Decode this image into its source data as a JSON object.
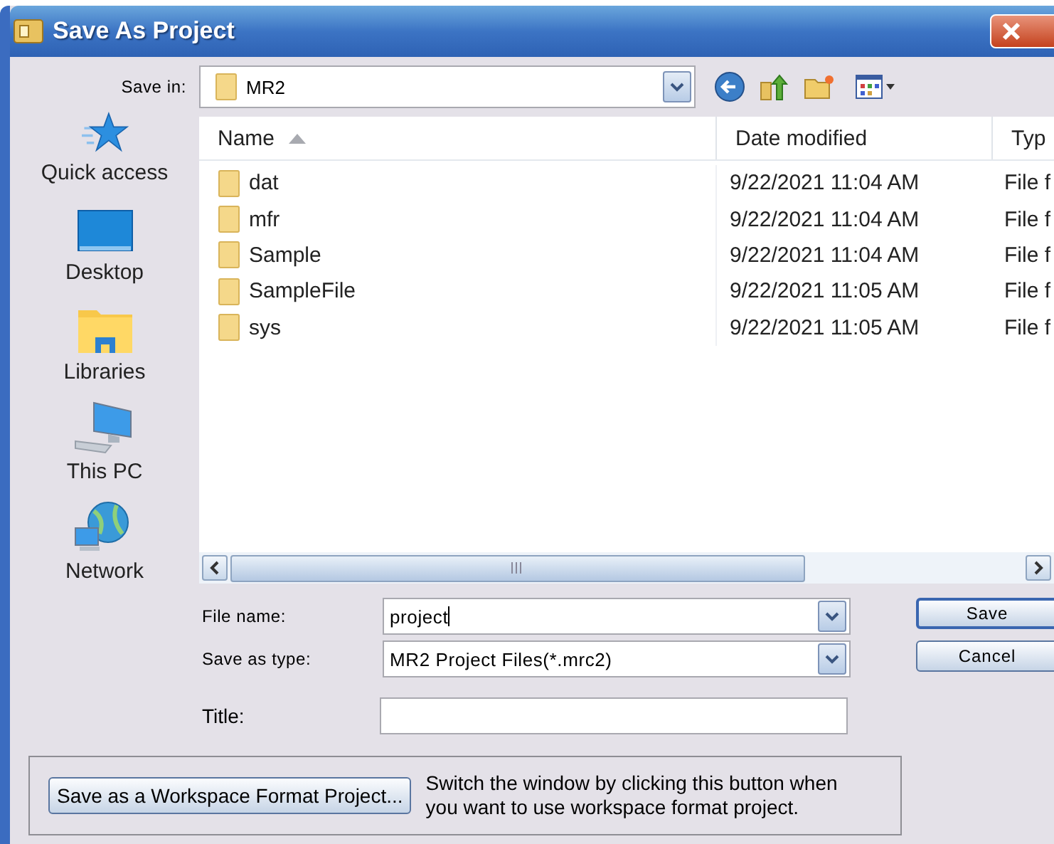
{
  "window": {
    "title": "Save As Project"
  },
  "save_in": {
    "label": "Save in:",
    "value": "MR2"
  },
  "places": [
    {
      "label": "Quick access",
      "kind": "star"
    },
    {
      "label": "Desktop",
      "kind": "desktop"
    },
    {
      "label": "Libraries",
      "kind": "libraries"
    },
    {
      "label": "This PC",
      "kind": "pc"
    },
    {
      "label": "Network",
      "kind": "network"
    }
  ],
  "columns": [
    {
      "label": "Name",
      "sorted": true
    },
    {
      "label": "Date modified",
      "sorted": false
    },
    {
      "label": "Typ",
      "sorted": false
    }
  ],
  "files": [
    {
      "name": "dat",
      "date": "9/22/2021 11:04 AM",
      "type": "File f"
    },
    {
      "name": "mfr",
      "date": "9/22/2021 11:04 AM",
      "type": "File f"
    },
    {
      "name": "Sample",
      "date": "9/22/2021 11:04 AM",
      "type": "File f"
    },
    {
      "name": "SampleFile",
      "date": "9/22/2021 11:05 AM",
      "type": "File f"
    },
    {
      "name": "sys",
      "date": "9/22/2021 11:05 AM",
      "type": "File f"
    }
  ],
  "file_name": {
    "label": "File name:",
    "value": "project"
  },
  "save_as_type": {
    "label": "Save as type:",
    "value": "MR2 Project Files(*.mrc2)"
  },
  "title_field": {
    "label": "Title:"
  },
  "buttons": [
    {
      "label": "Save",
      "default": true
    },
    {
      "label": "Cancel",
      "default": false
    }
  ],
  "workspace": {
    "button": "Save as a Workspace Format Project...",
    "note": "Switch the window by clicking this button when you want to use workspace format project."
  }
}
